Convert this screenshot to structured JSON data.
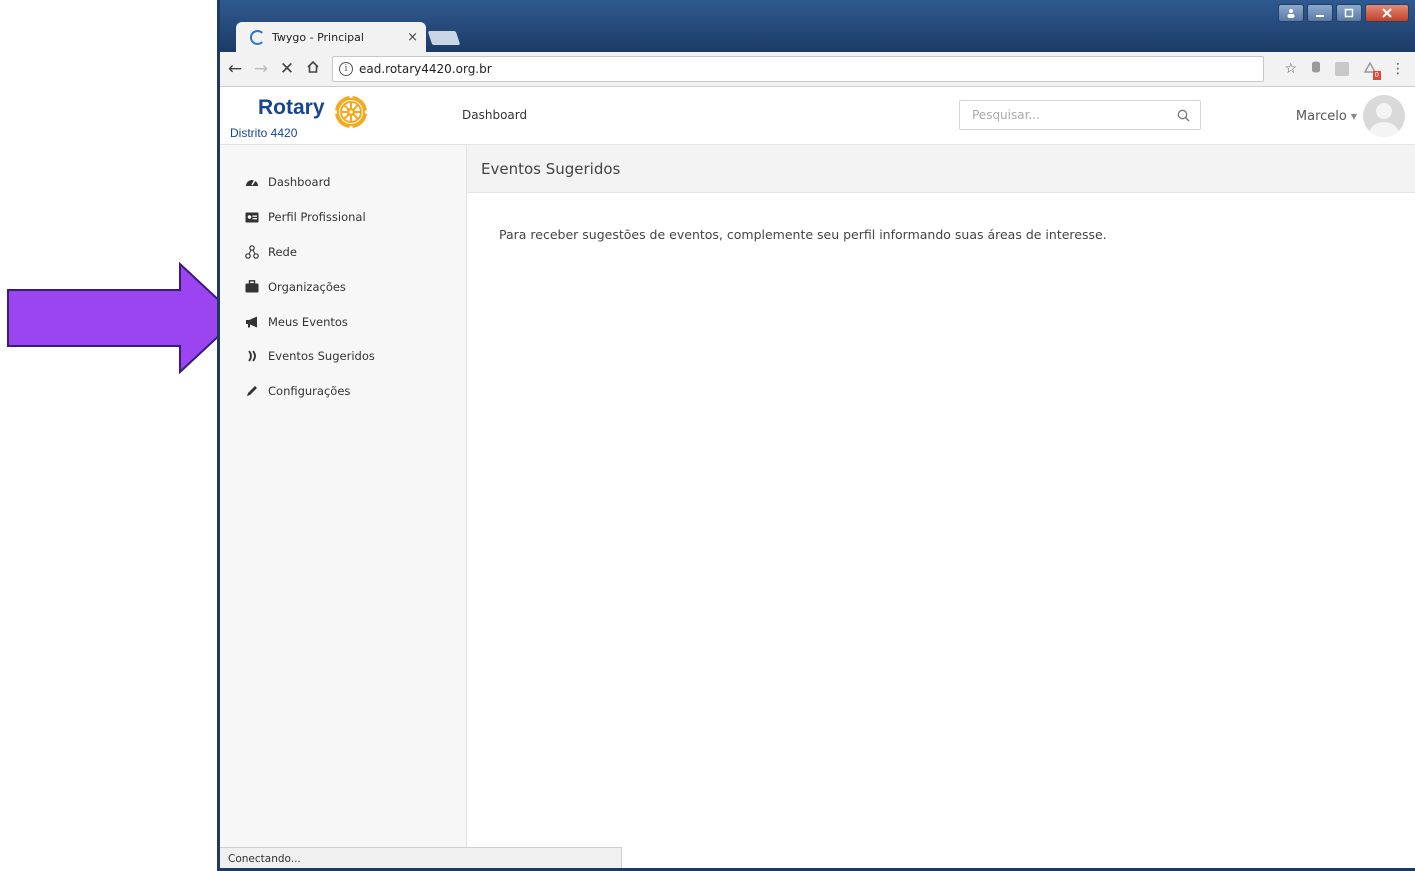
{
  "browser": {
    "tab_title": "Twygo - Principal",
    "tab_close": "×",
    "url": "ead.rotary4420.org.br",
    "status": "Conectando...",
    "window_controls": [
      "minimize",
      "maximize",
      "close"
    ]
  },
  "header": {
    "logo_name": "Rotary",
    "logo_sub": "Distrito 4420",
    "title": "Dashboard",
    "search_placeholder": "Pesquisar...",
    "user_name": "Marcelo"
  },
  "sidebar": {
    "items": [
      {
        "label": "Dashboard",
        "icon": "dashboard-gauge-icon"
      },
      {
        "label": "Perfil Profissional",
        "icon": "id-card-icon"
      },
      {
        "label": "Rede",
        "icon": "network-icon"
      },
      {
        "label": "Organizações",
        "icon": "briefcase-icon"
      },
      {
        "label": "Meus Eventos",
        "icon": "megaphone-icon"
      },
      {
        "label": "Eventos Sugeridos",
        "icon": "broadcast-icon"
      },
      {
        "label": "Configurações",
        "icon": "pencil-icon"
      }
    ]
  },
  "main": {
    "title": "Eventos Sugeridos",
    "message": "Para receber sugestões de eventos, complemente seu perfil informando suas áreas de interesse."
  },
  "colors": {
    "brand_blue": "#17458f",
    "brand_gold": "#f7a81b",
    "annotation_arrow": "#9b45f0"
  }
}
